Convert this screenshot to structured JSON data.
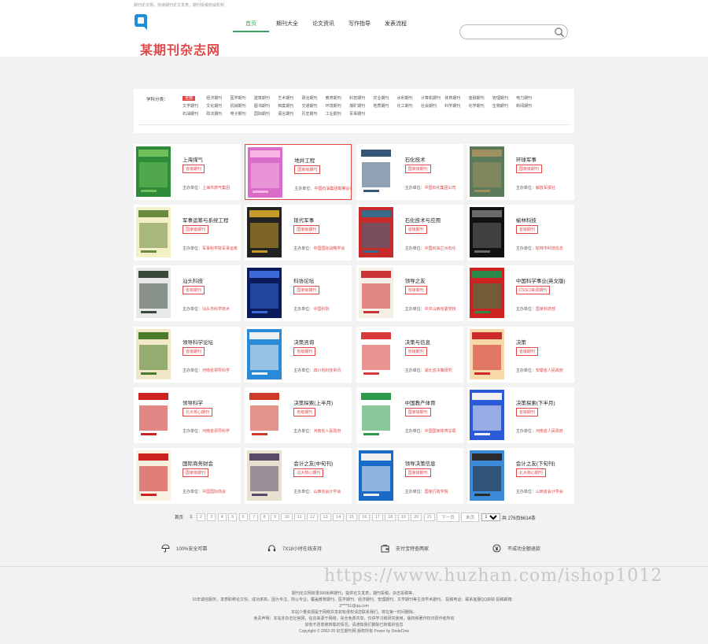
{
  "topbar": {
    "text": "期刊论文网，快速期刊论文发表，期刊投稿权威机构"
  },
  "brand": {
    "logo_text": "某期刊杂志网",
    "accent": "#e04848",
    "nav_accent": "#3aa35a"
  },
  "nav": [
    {
      "label": "首页",
      "active": true
    },
    {
      "label": "期刊大全"
    },
    {
      "label": "论文资讯"
    },
    {
      "label": "写作指导"
    },
    {
      "label": "发表流程"
    }
  ],
  "search": {
    "placeholder": "",
    "icon": "search-icon"
  },
  "categories": {
    "label": "学科分类：",
    "items": [
      "全部",
      "经济期刊",
      "医学期刊",
      "建筑期刊",
      "艺术期刊",
      "政治期刊",
      "教育期刊",
      "科技期刊",
      "农业期刊",
      "水利期刊",
      "计算机期刊",
      "体育期刊",
      "金融期刊",
      "管理期刊",
      "电力期刊",
      "文学期刊",
      "文化期刊",
      "机械期刊",
      "图书期刊",
      "档案期刊",
      "交通期刊",
      "环境期刊",
      "煤矿期刊",
      "地质期刊",
      "化工期刊",
      "社会期刊",
      "科学期刊",
      "化学期刊",
      "生物期刊",
      "新闻期刊",
      "石油期刊",
      "政法期刊",
      "电子期刊",
      "国际期刊",
      "语言期刊",
      "历史期刊",
      "工业期刊",
      "军事期刊"
    ]
  },
  "cards": [
    {
      "title": "上海煤气",
      "tag": "省级期刊",
      "org_label": "主办单位：",
      "org": "上海市燃气集团"
    },
    {
      "title": "地井工程",
      "tag": "国家级期刊",
      "org_label": "主办单位：",
      "org": "中国石油集团勘察设计"
    },
    {
      "title": "石化技术",
      "tag": "国家级期刊",
      "org_label": "主办单位：",
      "org": "中国石化集团公司"
    },
    {
      "title": "环球军事",
      "tag": "国家级期刊",
      "org_label": "主办单位：",
      "org": "解放军报社"
    },
    {
      "title": "军事运筹与系统工程",
      "tag": "国家级期刊",
      "org_label": "主办单位：",
      "org": "军事科学院军事运筹"
    },
    {
      "title": "现代军事",
      "tag": "国家级期刊",
      "org_label": "主办单位：",
      "org": "中国国际战略学会"
    },
    {
      "title": "石化技术与应用",
      "tag": "省级期刊",
      "org_label": "主办单位：",
      "org": "中国石油兰州石化"
    },
    {
      "title": "榆林科技",
      "tag": "省级期刊",
      "org_label": "主办单位：",
      "org": "榆林市科技信息"
    },
    {
      "title": "汕头科技",
      "tag": "省级期刊",
      "org_label": "主办单位：",
      "org": "汕头市科学技术"
    },
    {
      "title": "科协论坛",
      "tag": "国家级期刊",
      "org_label": "主办单位：",
      "org": "中国科协"
    },
    {
      "title": "领导之友",
      "tag": "省级期刊",
      "org_label": "主办单位：",
      "org": "中共山西省委党校"
    },
    {
      "title": "中国科学事业(英文版)",
      "tag": "CSSCI来源期刊",
      "org_label": "主办单位：",
      "org": "国家科技部"
    },
    {
      "title": "领导科学论坛",
      "tag": "省级期刊",
      "org_label": "主办单位：",
      "org": "河南省领导科学"
    },
    {
      "title": "决策咨询",
      "tag": "省级期刊",
      "org_label": "主办单位：",
      "org": "四川省科技资讯"
    },
    {
      "title": "决策与信息",
      "tag": "省级期刊",
      "org_label": "主办单位：",
      "org": "湖北省决策研究"
    },
    {
      "title": "决策",
      "tag": "省级期刊",
      "org_label": "主办单位：",
      "org": "安徽省人民政府"
    },
    {
      "title": "领导科学",
      "tag": "北大核心期刊",
      "org_label": "主办单位：",
      "org": "河南省领导科学"
    },
    {
      "title": "决策探索(上半月)",
      "tag": "省级期刊",
      "org_label": "主办单位：",
      "org": "河南省人民政府"
    },
    {
      "title": "中国教产体育",
      "tag": "国家级期刊",
      "org_label": "主办单位：",
      "org": "中国国家体育总局"
    },
    {
      "title": "决策探索(下半月)",
      "tag": "省级期刊",
      "org_label": "主办单位：",
      "org": "河南省人民政府"
    },
    {
      "title": "国际商务财会",
      "tag": "国家级期刊",
      "org_label": "主办单位：",
      "org": "中国国际商会"
    },
    {
      "title": "会计之友(中旬刊)",
      "tag": "北大核心期刊",
      "org_label": "主办单位：",
      "org": "山西省会计学会"
    },
    {
      "title": "领导决策信息",
      "tag": "国家级期刊",
      "org_label": "主办单位：",
      "org": "国家行政学院"
    },
    {
      "title": "会计之友(下旬刊)",
      "tag": "北大核心期刊",
      "org_label": "主办单位：",
      "org": "山西省会计学会"
    }
  ],
  "pager": {
    "first": "首页",
    "current": "1",
    "pages": [
      "2",
      "3",
      "4",
      "5",
      "6",
      "7",
      "8",
      "9",
      "10",
      "11",
      "12",
      "13",
      "14",
      "15",
      "16",
      "17",
      "18",
      "19",
      "20",
      "21"
    ],
    "next": "下一页",
    "last": "末页",
    "select_value": "1",
    "total": "共 276页6614条"
  },
  "features": [
    {
      "icon": "umbrella-icon",
      "text": "100%安全可靠"
    },
    {
      "icon": "headset-icon",
      "text": "7X18小时在线支持"
    },
    {
      "icon": "wallet-icon",
      "text": "支付宝特查两家"
    },
    {
      "icon": "yuan-icon",
      "text": "不成功全额退款"
    }
  ],
  "footer": {
    "lines": [
      "期刊论文网收录300余种期刊，提供论文发表，期刊投稿，杂志投稿等，",
      "15年诚信服务，发表职称论文快、成功率高，因为专注、所以专业。覆盖教育期刊、医学期刊、经济期刊、管理期刊、文学期刊等主流学术期刊。 投稿电话：联系客服QQ获取  投稿邮箱：",
      "3****51@qq.com",
      "本站少量资源属于网络共享如有侵权请您联系我们，将在第一时间删除。",
      "免责声明：本站非杂志社官网，信息来源于网络，完全免费共享，仅供学习和研究使用，版权和著作权归原作者所有",
      "如有不愿意被转载的情况，请通知我们删除已转载的信息",
      "Copyright © 2002-20 好生期刊网 版权所有 Power by DedeCms"
    ]
  },
  "watermark": "https://www.huzhan.com/ishop1012"
}
